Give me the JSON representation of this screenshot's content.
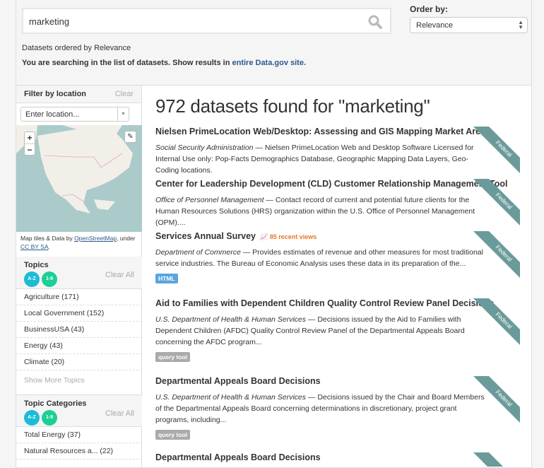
{
  "search": {
    "value": "marketing",
    "order_label": "Order by:",
    "order_value": "Relevance",
    "ordered_text": "Datasets ordered by Relevance",
    "scope_text": "You are searching in the list of datasets. Show results in ",
    "scope_link": "entire Data.gov site."
  },
  "sidebar": {
    "location": {
      "title": "Filter by location",
      "clear": "Clear",
      "placeholder": "Enter location...",
      "attr_prefix": "Map tiles & Data by ",
      "osm": "OpenStreetMap",
      "attr_mid": ", under ",
      "license": "CC BY SA"
    },
    "topics": {
      "title": "Topics",
      "sort_az": "A-Z",
      "sort_19": "1-9",
      "clear": "Clear All",
      "items": [
        "Agriculture (171)",
        "Local Government (152)",
        "BusinessUSA (43)",
        "Energy (43)",
        "Climate (20)"
      ],
      "more": "Show More Topics"
    },
    "categories": {
      "title": "Topic Categories",
      "sort_az": "A-Z",
      "sort_19": "1-9",
      "clear": "Clear All",
      "items": [
        "Total Energy (37)",
        "Natural Resources a... (22)"
      ]
    }
  },
  "main": {
    "heading": "972 datasets found for \"marketing\"",
    "ribbon": "Federal",
    "results": [
      {
        "title": "Nielsen PrimeLocation Web/Desktop: Assessing and GIS Mapping Market Area",
        "org": "Social Security Administration",
        "desc": " — Nielsen PrimeLocation Web and Desktop Software Licensed for Internal Use only: Pop-Facts Demographics Database, Geographic Mapping Data Layers, Geo-Coding locations."
      },
      {
        "title": "Center for Leadership Development (CLD) Customer Relationship Management Tool",
        "org": "Office of Personnel Management",
        "desc": " — Contact record of current and potential future clients for the Human Resources Solutions (HRS) organization within the U.S. Office of Personnel Management (OPM)...."
      },
      {
        "title": "Services Annual Survey",
        "views": "85 recent views",
        "org": "Department of Commerce",
        "desc": " — Provides estimates of revenue and other measures for most traditional service industries. The Bureau of Economic Analysis uses these data in its preparation of the...",
        "format": "HTML"
      },
      {
        "title": "Aid to Families with Dependent Children Quality Control Review Panel Decisions",
        "org": "U.S. Department of Health & Human Services",
        "desc": " — Decisions issued by the Aid to Families with Dependent Children (AFDC) Quality Control Review Panel of the Departmental Appeals Board concerning the AFDC program...",
        "format": "query tool"
      },
      {
        "title": "Departmental Appeals Board Decisions",
        "org": "U.S. Department of Health & Human Services",
        "desc": " — Decisions issued by the Chair and Board Members of the Departmental Appeals Board concerning determinations in discretionary, project grant programs, including...",
        "format": "query tool"
      },
      {
        "title": "Departmental Appeals Board Decisions"
      }
    ]
  },
  "colors": {
    "ribbon": "#6b9a9b",
    "az": "#1bbcd6",
    "n19": "#1ccf96",
    "html": "#5aa6dc",
    "query": "#aaaaaa",
    "views": "#e87722"
  }
}
